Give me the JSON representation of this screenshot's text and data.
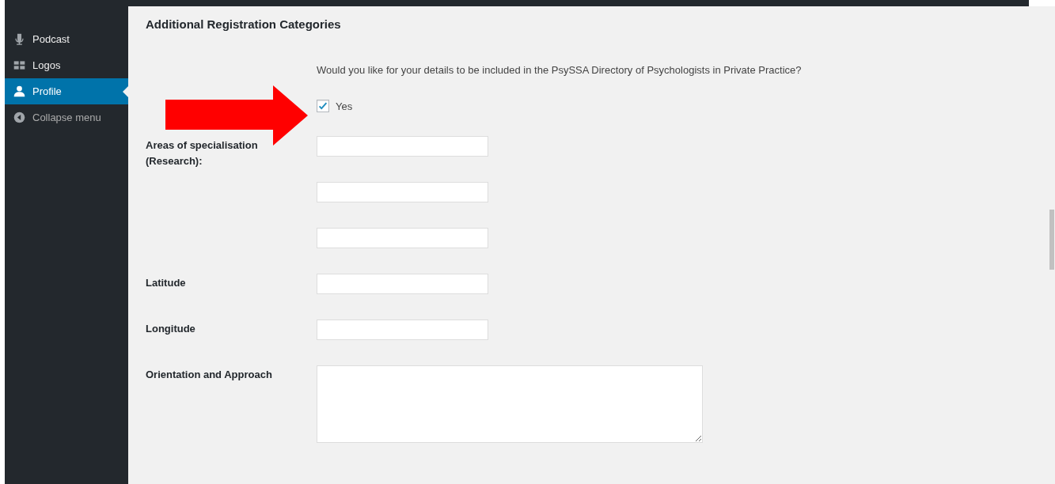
{
  "sidebar": {
    "items": [
      {
        "label": "Podcast",
        "selected": false
      },
      {
        "label": "Logos",
        "selected": false
      },
      {
        "label": "Profile",
        "selected": true
      },
      {
        "label": "Collapse menu",
        "kind": "collapse",
        "selected": false
      }
    ]
  },
  "section": {
    "title": "Additional Registration Categories",
    "question": "Would you like for your details to be included in the PsySSA Directory of Psychologists in Private Practice?",
    "checkbox": {
      "label": "Yes",
      "checked": true
    },
    "fields": [
      {
        "label": "Areas of specialisation (Research):",
        "kind": "text"
      },
      {
        "kind": "text"
      },
      {
        "kind": "text"
      },
      {
        "label": "Latitude",
        "kind": "text"
      },
      {
        "label": "Longitude",
        "kind": "text"
      },
      {
        "label": "Orientation and Approach",
        "kind": "textarea"
      }
    ]
  }
}
